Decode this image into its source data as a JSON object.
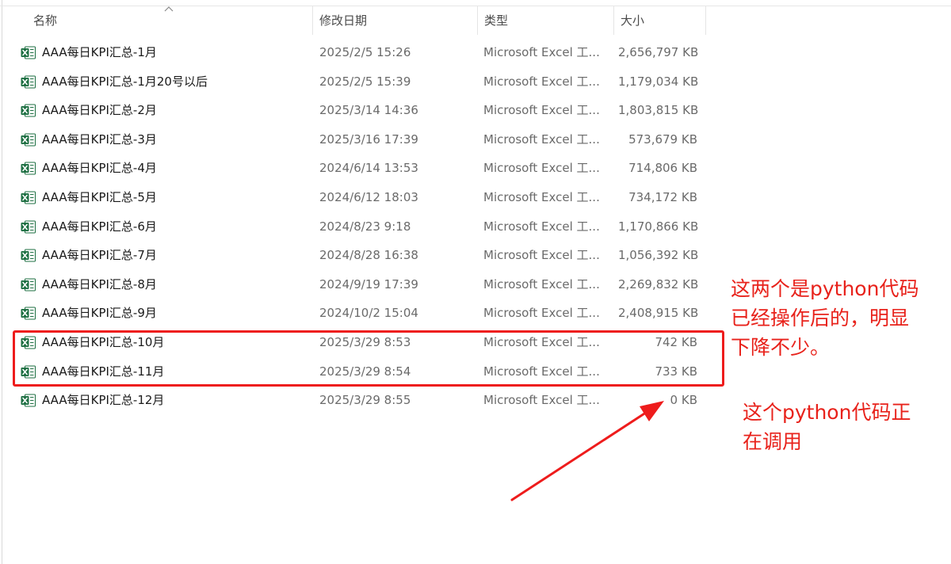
{
  "columns": {
    "name": "名称",
    "date": "修改日期",
    "type": "类型",
    "size": "大小"
  },
  "files": [
    {
      "name": "AAA每日KPI汇总-1月",
      "date": "2025/2/5 15:26",
      "type": "Microsoft Excel 工...",
      "size": "2,656,797 KB",
      "icon": "excel-file-icon"
    },
    {
      "name": "AAA每日KPI汇总-1月20号以后",
      "date": "2025/2/5 15:39",
      "type": "Microsoft Excel 工...",
      "size": "1,179,034 KB",
      "icon": "excel-file-icon"
    },
    {
      "name": "AAA每日KPI汇总-2月",
      "date": "2025/3/14 14:36",
      "type": "Microsoft Excel 工...",
      "size": "1,803,815 KB",
      "icon": "excel-file-icon"
    },
    {
      "name": "AAA每日KPI汇总-3月",
      "date": "2025/3/16 17:39",
      "type": "Microsoft Excel 工...",
      "size": "573,679 KB",
      "icon": "excel-file-icon"
    },
    {
      "name": "AAA每日KPI汇总-4月",
      "date": "2024/6/14 13:53",
      "type": "Microsoft Excel 工...",
      "size": "714,806 KB",
      "icon": "excel-file-icon"
    },
    {
      "name": "AAA每日KPI汇总-5月",
      "date": "2024/6/12 18:03",
      "type": "Microsoft Excel 工...",
      "size": "734,172 KB",
      "icon": "excel-file-icon"
    },
    {
      "name": "AAA每日KPI汇总-6月",
      "date": "2024/8/23 9:18",
      "type": "Microsoft Excel 工...",
      "size": "1,170,866 KB",
      "icon": "excel-file-icon"
    },
    {
      "name": "AAA每日KPI汇总-7月",
      "date": "2024/8/28 16:38",
      "type": "Microsoft Excel 工...",
      "size": "1,056,392 KB",
      "icon": "excel-file-icon"
    },
    {
      "name": "AAA每日KPI汇总-8月",
      "date": "2024/9/19 17:39",
      "type": "Microsoft Excel 工...",
      "size": "2,269,832 KB",
      "icon": "excel-file-icon"
    },
    {
      "name": "AAA每日KPI汇总-9月",
      "date": "2024/10/2 15:04",
      "type": "Microsoft Excel 工...",
      "size": "2,408,915 KB",
      "icon": "excel-file-icon"
    },
    {
      "name": "AAA每日KPI汇总-10月",
      "date": "2025/3/29 8:53",
      "type": "Microsoft Excel 工...",
      "size": "742 KB",
      "icon": "excel-file-icon"
    },
    {
      "name": "AAA每日KPI汇总-11月",
      "date": "2025/3/29 8:54",
      "type": "Microsoft Excel 工...",
      "size": "733 KB",
      "icon": "excel-file-icon"
    },
    {
      "name": "AAA每日KPI汇总-12月",
      "date": "2025/3/29 8:55",
      "type": "Microsoft Excel 工...",
      "size": "0 KB",
      "icon": "excel-file-icon"
    }
  ],
  "annotations": {
    "processed_note": [
      "这两个是python代码",
      "已经操作后的，明显",
      "下降不少。"
    ],
    "running_note": [
      "这个python代码正",
      "在调用"
    ],
    "color": "#e8221b"
  },
  "colors": {
    "excel_green": "#1d6f42",
    "header_text": "#4a4a4a",
    "secondary_text": "#6a6a6a"
  }
}
